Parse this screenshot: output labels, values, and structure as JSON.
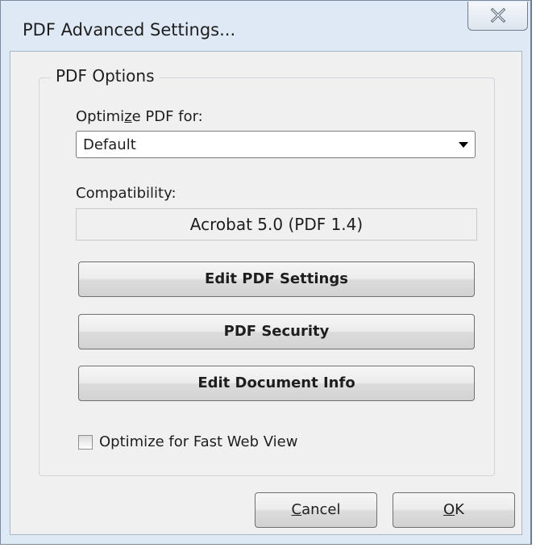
{
  "window": {
    "title": "PDF Advanced Settings...",
    "close_icon": "close-x-icon"
  },
  "group": {
    "legend": "PDF Options"
  },
  "optimize": {
    "label_pre": "Optimi",
    "label_access": "z",
    "label_post": "e PDF for:",
    "selected": "Default"
  },
  "compatibility": {
    "label": "Compatibility:",
    "value": "Acrobat 5.0 (PDF 1.4)"
  },
  "buttons": {
    "edit_pdf_settings": "Edit PDF Settings",
    "pdf_security": "PDF Security",
    "edit_document_info": "Edit Document Info"
  },
  "fast_web_view": {
    "label": "Optimize for Fast Web View",
    "checked": false
  },
  "footer": {
    "cancel_access": "C",
    "cancel_rest": "ancel",
    "ok_access": "O",
    "ok_rest": "K"
  }
}
